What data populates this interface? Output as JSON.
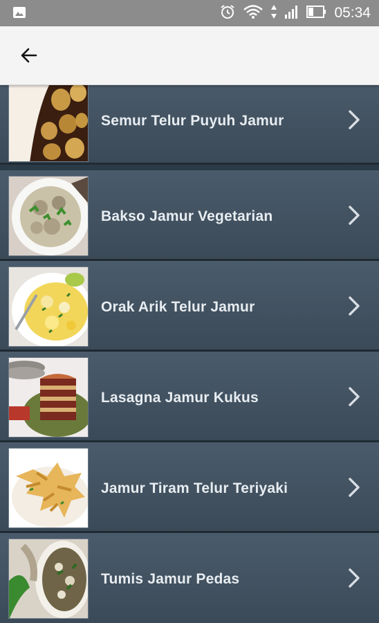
{
  "status_bar": {
    "time": "05:34",
    "icons": [
      "image-icon",
      "alarm-icon",
      "wifi-icon",
      "signal-icon",
      "battery-icon"
    ]
  },
  "toolbar": {
    "back_icon": "back-arrow-icon"
  },
  "recipes": [
    {
      "title": "Semur Telur Puyuh Jamur",
      "image": "quail-egg-stew-photo"
    },
    {
      "title": "Bakso Jamur Vegetarian",
      "image": "vegetarian-meatball-soup-photo"
    },
    {
      "title": "Orak Arik Telur Jamur",
      "image": "scrambled-egg-mushroom-photo"
    },
    {
      "title": "Lasagna Jamur Kukus",
      "image": "steamed-mushroom-lasagna-photo"
    },
    {
      "title": "Jamur Tiram Telur Teriyaki",
      "image": "fried-oyster-mushroom-photo"
    },
    {
      "title": "Tumis Jamur Pedas",
      "image": "spicy-stir-fry-mushroom-photo"
    }
  ],
  "colors": {
    "status_bar": "#8c8c8c",
    "toolbar": "#f4f4f4",
    "list_item": "#44545f",
    "title_text": "#e8edf1"
  }
}
